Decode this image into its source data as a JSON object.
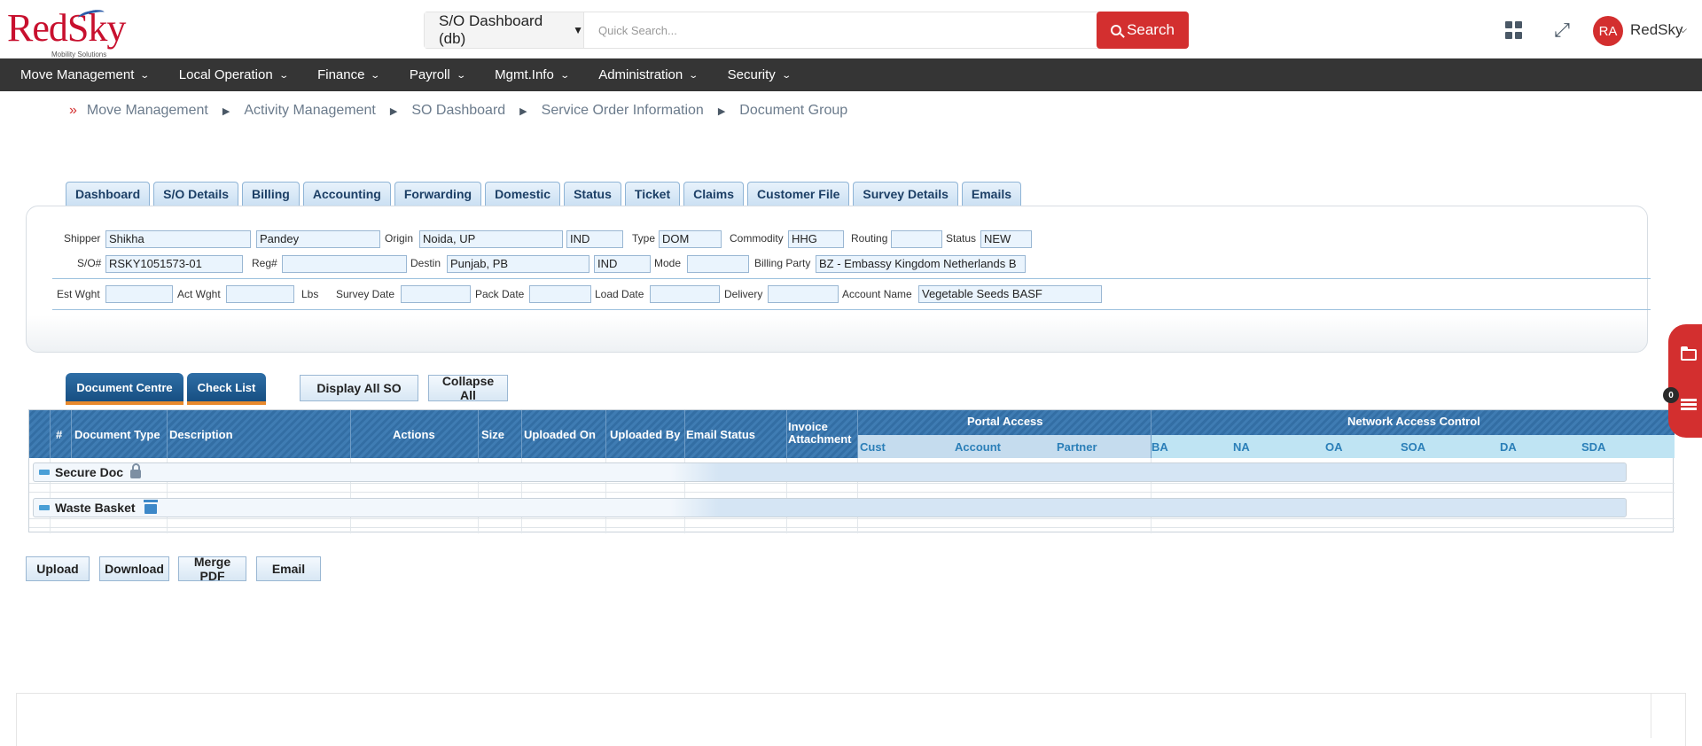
{
  "header": {
    "logo_text": "RedSky",
    "logo_sub": "Mobility Solutions",
    "search_scope": "S/O Dashboard (db)",
    "search_placeholder": "Quick Search...",
    "search_button": "Search",
    "avatar_initials": "RA",
    "user_name": "RedSky"
  },
  "nav": {
    "items": [
      "Move Management",
      "Local Operation",
      "Finance",
      "Payroll",
      "Mgmt.Info",
      "Administration",
      "Security"
    ]
  },
  "breadcrumb": [
    "Move Management",
    "Activity Management",
    "SO Dashboard",
    "Service Order Information",
    "Document Group"
  ],
  "tabs": [
    "Dashboard",
    "S/O Details",
    "Billing",
    "Accounting",
    "Forwarding",
    "Domestic",
    "Status",
    "Ticket",
    "Claims",
    "Customer File",
    "Survey Details",
    "Emails"
  ],
  "info": {
    "labels": {
      "shipper": "Shipper",
      "origin": "Origin",
      "type": "Type",
      "commodity": "Commodity",
      "routing": "Routing",
      "status": "Status",
      "so": "S/O#",
      "reg": "Reg#",
      "destin": "Destin",
      "mode": "Mode",
      "billing_party": "Billing Party",
      "est_wght": "Est Wght",
      "act_wght": "Act Wght",
      "lbs": "Lbs",
      "survey_date": "Survey Date",
      "pack_date": "Pack Date",
      "load_date": "Load Date",
      "delivery": "Delivery",
      "account_name": "Account Name"
    },
    "values": {
      "shipper_first": "Shikha",
      "shipper_last": "Pandey",
      "origin": "Noida, UP",
      "origin_country": "IND",
      "type": "DOM",
      "commodity": "HHG",
      "routing": "",
      "status": "NEW",
      "so": "RSKY1051573-01",
      "reg": "",
      "destin": "Punjab, PB",
      "destin_country": "IND",
      "mode": "",
      "billing_party": "BZ - Embassy Kingdom Netherlands B",
      "est_wght": "",
      "act_wght": "",
      "survey_date": "",
      "pack_date": "",
      "load_date": "",
      "delivery": "",
      "account_name": "Vegetable Seeds BASF"
    }
  },
  "doc_tabs": [
    "Document Centre",
    "Check List"
  ],
  "doc_buttons": [
    "Display All SO",
    "Collapse All"
  ],
  "grid": {
    "columns": [
      "#",
      "Document Type",
      "Description",
      "Actions",
      "Size",
      "Uploaded On",
      "Uploaded By",
      "Email Status",
      "Invoice Attachment"
    ],
    "portal_access": "Portal Access",
    "portal_cols": [
      "Cust",
      "Account",
      "Partner"
    ],
    "network_access": "Network Access Control",
    "network_cols": [
      "BA",
      "NA",
      "OA",
      "SOA",
      "DA",
      "SDA"
    ],
    "groups": [
      "Secure Doc",
      "Waste Basket"
    ]
  },
  "bottom_buttons": [
    "Upload",
    "Download",
    "Merge PDF",
    "Email"
  ],
  "side_badge_count": "0",
  "colors": {
    "brand_red": "#d32f2f",
    "nav_bg": "#353535",
    "grid_header": "#3f7cb3"
  }
}
